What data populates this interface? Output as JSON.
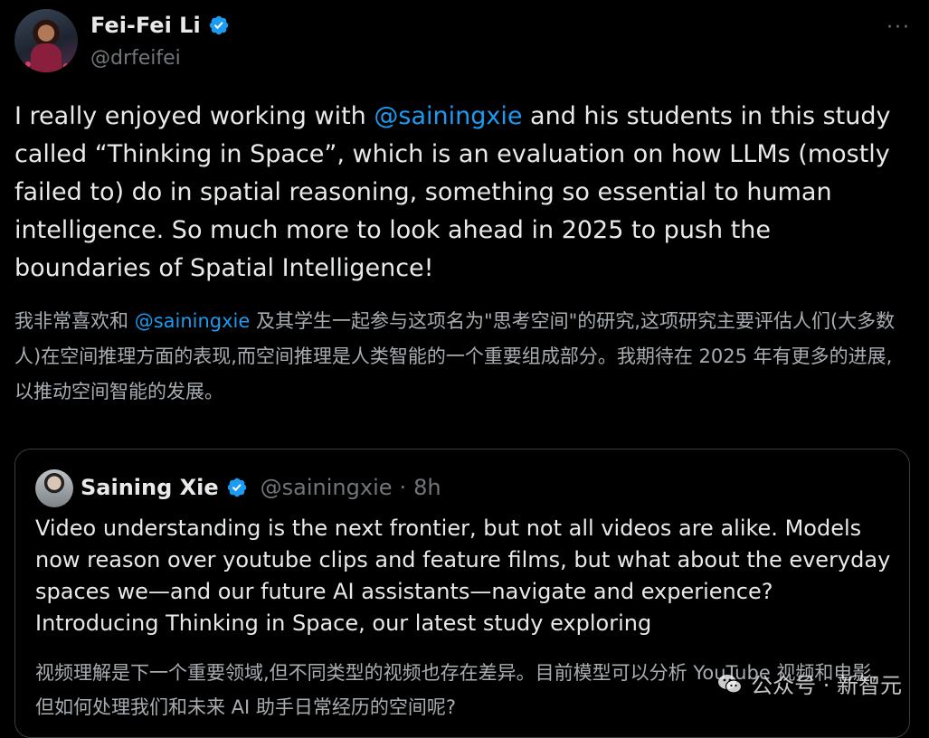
{
  "tweet": {
    "author": {
      "name": "Fei-Fei Li",
      "handle": "@drfeifei",
      "verified": true
    },
    "more_label": "···",
    "text_before": "I really enjoyed working with ",
    "mention": "@sainingxie",
    "text_after": " and his students in this study called “Thinking in Space”, which is an evaluation on how LLMs (mostly failed to) do in spatial reasoning, something so essential to human intelligence. So much more to look ahead in 2025 to push the boundaries of Spatial Intelligence!",
    "translation_before": "我非常喜欢和 ",
    "translation_mention": "@sainingxie",
    "translation_after": " 及其学生一起参与这项名为\"思考空间\"的研究,这项研究主要评估人们(大多数人)在空间推理方面的表现,而空间推理是人类智能的一个重要组成部分。我期待在 2025 年有更多的进展,以推动空间智能的发展。"
  },
  "quote": {
    "author": {
      "name": "Saining Xie",
      "handle": "@sainingxie",
      "time": "8h",
      "verified": true
    },
    "separator": "·",
    "text_line1": "Video understanding is the next frontier, but not all videos are alike. Models now reason over youtube clips and feature films, but what about the everyday spaces we—and our future AI assistants—navigate and experience?",
    "text_line2": "Introducing Thinking in Space, our latest study exploring",
    "translation": "视频理解是下一个重要领域,但不同类型的视频也存在差异。目前模型可以分析 YouTube 视频和电影,但如何处理我们和未来 AI 助手日常经历的空间呢?"
  },
  "watermark": {
    "icon": "wechat-icon",
    "text": "公众号 · 新智元"
  },
  "colors": {
    "background": "#000000",
    "text": "#e7e9ea",
    "muted": "#71767b",
    "link": "#1d9bf0",
    "verified": "#1d9bf0"
  }
}
